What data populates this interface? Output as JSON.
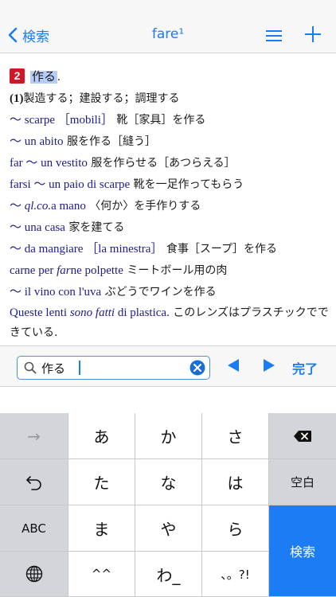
{
  "header": {
    "back_label": "検索",
    "title": "fare¹"
  },
  "entry": {
    "sense_number": "2",
    "sense_word": "作る",
    "sense_period": ".",
    "lines": [
      {
        "jp": "",
        "parts": [
          {
            "t": "(1)",
            "c": "bold"
          },
          {
            "t": "製造する；建設する；調理する",
            "c": "jp"
          }
        ]
      },
      {
        "parts": [
          {
            "t": "〜 scarpe ［mobili］",
            "c": "it"
          },
          {
            "t": " 靴［家具］を作る",
            "c": "jp"
          }
        ]
      },
      {
        "parts": [
          {
            "t": "〜 un abito",
            "c": "it"
          },
          {
            "t": " 服を作る［縫う］",
            "c": "jp"
          }
        ]
      },
      {
        "parts": [
          {
            "t": "far 〜 un vestito",
            "c": "it"
          },
          {
            "t": " 服を作らせる［あつらえる］",
            "c": "jp"
          }
        ]
      },
      {
        "parts": [
          {
            "t": "farsi 〜 un paio di scarpe",
            "c": "it"
          },
          {
            "t": " 靴を一足作ってもらう",
            "c": "jp"
          }
        ]
      },
      {
        "parts": [
          {
            "t": "〜 ",
            "c": "it"
          },
          {
            "t": "ql.co.",
            "c": "it ital"
          },
          {
            "t": "a mano",
            "c": "it"
          },
          {
            "t": " 〈何か〉を手作りする",
            "c": "jp"
          }
        ]
      },
      {
        "parts": [
          {
            "t": "〜 una casa",
            "c": "it"
          },
          {
            "t": " 家を建てる",
            "c": "jp"
          }
        ]
      },
      {
        "parts": [
          {
            "t": "〜 da mangiare ［la minestra］",
            "c": "it"
          },
          {
            "t": " 食事［スープ］を作る",
            "c": "jp"
          }
        ]
      },
      {
        "parts": [
          {
            "t": "carne per ",
            "c": "it"
          },
          {
            "t": "far",
            "c": "it ital"
          },
          {
            "t": "ne polpette",
            "c": "it"
          },
          {
            "t": " ミートボール用の肉",
            "c": "jp"
          }
        ]
      },
      {
        "parts": [
          {
            "t": "〜 il vino con l'uva",
            "c": "it"
          },
          {
            "t": " ぶどうでワインを作る",
            "c": "jp"
          }
        ]
      },
      {
        "wrap": true,
        "parts": [
          {
            "t": "Queste lenti ",
            "c": "it"
          },
          {
            "t": "sono fatti",
            "c": "it ital"
          },
          {
            "t": " di plastica.",
            "c": "it"
          },
          {
            "t": " このレンズはプラスチックでできている.",
            "c": "jp"
          }
        ]
      }
    ]
  },
  "search": {
    "value": "作る",
    "done_label": "完了"
  },
  "keyboard": {
    "keys": [
      "→",
      "あ",
      "か",
      "さ",
      "",
      "",
      "た",
      "な",
      "は",
      "空白",
      "ABC",
      "ま",
      "や",
      "ら",
      "検索",
      "",
      "^^",
      "わ_",
      "、。?!"
    ]
  },
  "colors": {
    "accent": "#1a7cf5",
    "badge": "#d0172a",
    "italian_text": "#1c1c8a",
    "highlight": "#b6cdf7"
  }
}
